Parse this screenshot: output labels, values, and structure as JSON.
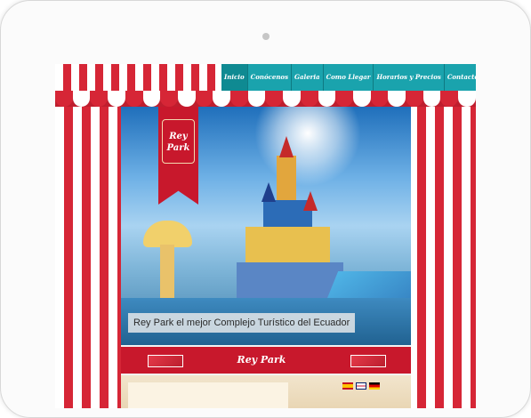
{
  "nav": {
    "items": [
      "Inicio",
      "Conócenos",
      "Galeria",
      "Como Llegar",
      "Horarios y Precios",
      "Contactenos"
    ],
    "active_index": 0
  },
  "logo": {
    "text": "Rey\nPark"
  },
  "hero": {
    "caption": "Rey Park el mejor Complejo Turístico del Ecuador"
  },
  "bar": {
    "logo_text": "Rey Park"
  },
  "colors": {
    "awning_red": "#d62636",
    "nav_teal": "#1aa3ad",
    "banner_red": "#c8182c"
  },
  "flags": [
    "spain-flag",
    "uk-flag",
    "germany-flag"
  ]
}
